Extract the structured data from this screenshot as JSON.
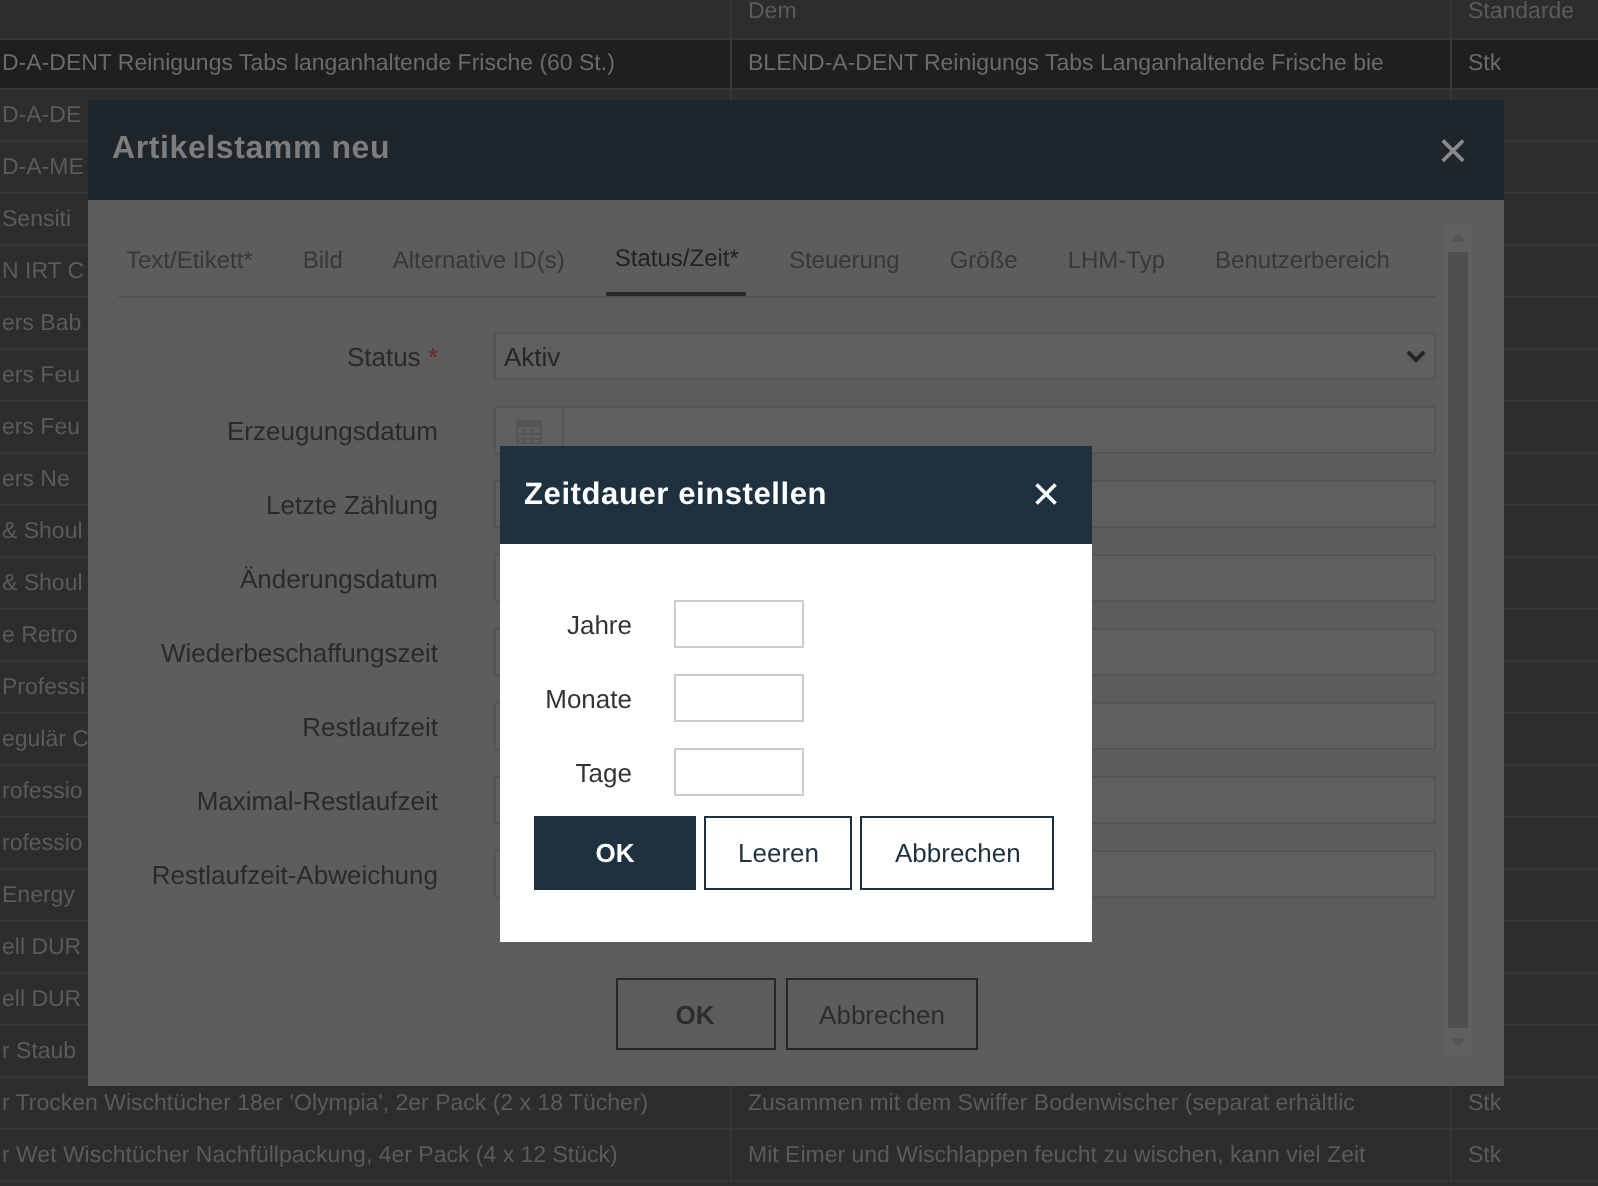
{
  "background_table": {
    "header": {
      "column_2": "Dem",
      "column_3": "Standarde"
    },
    "rows": [
      {
        "column_1": "D-A-DENT Reinigungs Tabs langanhaltende Frische (60 St.)",
        "column_2": "BLEND-A-DENT Reinigungs Tabs Langanhaltende Frische bie",
        "column_3": "Stk",
        "selected": true
      },
      {
        "column_1": "D-A-DE",
        "selected": false
      },
      {
        "column_1": "D-A-ME",
        "selected": false
      },
      {
        "column_1": "Sensiti",
        "selected": false
      },
      {
        "column_1": "N IRT C",
        "selected": false
      },
      {
        "column_1": "ers Bab",
        "selected": false
      },
      {
        "column_1": "ers Feu",
        "selected": false
      },
      {
        "column_1": "ers Feu",
        "selected": false
      },
      {
        "column_1": "ers Ne",
        "selected": false
      },
      {
        "column_1": "& Shoul",
        "selected": false
      },
      {
        "column_1": "& Shoul",
        "selected": false
      },
      {
        "column_1": "e Retro",
        "selected": false
      },
      {
        "column_1": "Professi",
        "selected": false
      },
      {
        "column_1": "egulär C",
        "selected": false
      },
      {
        "column_1": "rofessio",
        "selected": false
      },
      {
        "column_1": "rofessio",
        "selected": false
      },
      {
        "column_1": "Energy",
        "selected": false
      },
      {
        "column_1": "ell DUR",
        "selected": false
      },
      {
        "column_1": "ell DUR",
        "selected": false
      },
      {
        "column_1": "r Staub",
        "selected": false
      },
      {
        "column_1": "r Trocken Wischtücher 18er 'Olympia', 2er Pack (2 x 18 Tücher)",
        "column_2": "Zusammen mit dem Swiffer Bodenwischer (separat erhältlic",
        "column_3": "Stk",
        "selected": false
      },
      {
        "column_1": "r Wet Wischtücher Nachfüllpackung, 4er Pack (4 x 12 Stück)",
        "column_2": "Mit Eimer und Wischlappen feucht zu wischen, kann viel Zeit",
        "column_3": "Stk",
        "selected": false
      }
    ]
  },
  "article_dialog": {
    "title": "Artikelstamm neu",
    "close": "×",
    "tabs": [
      {
        "label": "Text/Etikett*",
        "selected": false
      },
      {
        "label": "Bild",
        "selected": false
      },
      {
        "label": "Alternative ID(s)",
        "selected": false
      },
      {
        "label": "Status/Zeit*",
        "selected": true
      },
      {
        "label": "Steuerung",
        "selected": false
      },
      {
        "label": "Größe",
        "selected": false
      },
      {
        "label": "LHM-Typ",
        "selected": false
      },
      {
        "label": "Benutzerbereich",
        "selected": false
      }
    ],
    "fields": [
      {
        "kind": "select",
        "label": "Status",
        "required_mark": "*",
        "value": "Aktiv"
      },
      {
        "kind": "date",
        "label": "Erzeugungsdatum"
      },
      {
        "kind": "text",
        "label": "Letzte Zählung"
      },
      {
        "kind": "text",
        "label": "Änderungsdatum"
      },
      {
        "kind": "text",
        "label": "Wiederbeschaffungszeit"
      },
      {
        "kind": "text",
        "label": "Restlaufzeit"
      },
      {
        "kind": "text",
        "label": "Maximal-Restlaufzeit"
      },
      {
        "kind": "text",
        "label": "Restlaufzeit-Abweichung"
      }
    ],
    "buttons": [
      "OK",
      "Abbrechen"
    ]
  },
  "duration_dialog": {
    "title": "Zeitdauer einstellen",
    "close": "×",
    "fields": [
      {
        "label": "Jahre"
      },
      {
        "label": "Monate"
      },
      {
        "label": "Tage"
      }
    ],
    "buttons": [
      {
        "label": "OK",
        "primary": true
      },
      {
        "label": "Leeren",
        "primary": false
      },
      {
        "label": "Abbrechen",
        "primary": false
      }
    ]
  }
}
